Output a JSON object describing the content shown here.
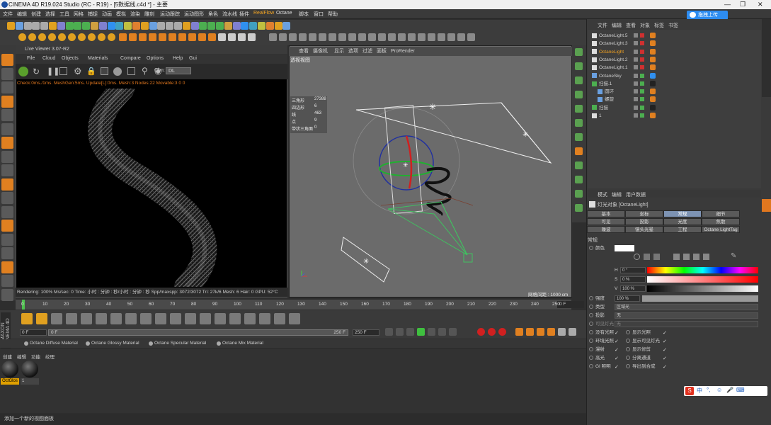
{
  "window": {
    "title": "CINEMA 4D R19.024 Studio (RC - R19) - [5数据线.c4d *] - 主要"
  },
  "menubar": [
    "文件",
    "编辑",
    "创建",
    "选择",
    "工具",
    "网格",
    "捕捉",
    "动画",
    "模拟",
    "渲染",
    "雕刻",
    "运动跟踪",
    "运动图形",
    "角色",
    "流水线",
    "插件",
    "RealFlow",
    "Octane",
    "脚本",
    "窗口",
    "帮助"
  ],
  "cloud_button": "拖拽上传",
  "liveviewer": {
    "title": "Live Viewer 3.07-R2",
    "menu": [
      "File",
      "Cloud",
      "Objects",
      "Materials",
      "Compare",
      "Options",
      "Help",
      "Gui"
    ],
    "chn_label": "Chn:",
    "chn_value": "DL",
    "status": "Check:0ms./1ms. MeshGen:5ms. Update[L]:0ms. Mesh:3 Nodes:22 Movable:3  0 0",
    "render_info": "Rendering: 100%   Ms/sec: 0   Time: 小时 : 分钟 : 秒/小时 : 分钟 : 秒   Spp/maxspp: 3072/3072   Tri: 27k/6   Mesh: 6   Hair: 0   GPU:   52°C"
  },
  "viewport": {
    "menu": [
      "查看",
      "摄像机",
      "显示",
      "选项",
      "过滤",
      "面板",
      "ProRender"
    ],
    "label": "透视视图",
    "stats": [
      [
        "三角形",
        "27388"
      ],
      [
        "四边形",
        "6"
      ],
      [
        "线",
        "463"
      ],
      [
        "点",
        "9"
      ],
      [
        "带状三角面",
        "0"
      ]
    ],
    "grid_info": "网格间距 : 1000 cm"
  },
  "timeline": {
    "ticks": [
      "0",
      "10",
      "20",
      "30",
      "40",
      "50",
      "60",
      "70",
      "80",
      "90",
      "100",
      "110",
      "120",
      "130",
      "140",
      "150",
      "160",
      "170",
      "180",
      "190",
      "200",
      "210",
      "220",
      "230",
      "240",
      "250"
    ],
    "end_frame": "0 F"
  },
  "anim": {
    "start": "0 F",
    "range_start": "0 F",
    "range_end": "250 F",
    "end": "250 F"
  },
  "materials": {
    "tabs": [
      "Octane Diffuse Material",
      "Octane Glossy Material",
      "Octane Specular Material",
      "Octane Mix Material"
    ],
    "menu": [
      "创建",
      "编辑",
      "功能",
      "纹理"
    ],
    "items": [
      "OctGlos",
      "1"
    ]
  },
  "status_bar": "添加一个新的视图面板",
  "object_manager": {
    "menu": [
      "文件",
      "编辑",
      "查看",
      "对象",
      "标签",
      "书签"
    ],
    "objects": [
      "OctaneLight.5",
      "OctaneLight.3",
      "OctaneLight",
      "OctaneLight.2",
      "OctaneLight.1",
      "OctaneSky",
      "扫描.1",
      "圆环",
      "螺旋",
      "扫描",
      "1"
    ]
  },
  "attributes": {
    "menu": [
      "模式",
      "编辑",
      "用户数据"
    ],
    "object_title": "灯光对象 [OctaneLight]",
    "tabs": [
      "基本",
      "坐标",
      "常规",
      "细节",
      "可见",
      "投影",
      "光度",
      "焦散",
      "噪波",
      "镜头光晕",
      "工程",
      "Octane LightTag"
    ],
    "section": "常规",
    "color_label": "颜色",
    "h_label": "H",
    "h_value": "0 °",
    "s_label": "S",
    "s_value": "0 %",
    "v_label": "V",
    "v_value": "100 %",
    "intensity_label": "强度",
    "intensity_value": "100 %",
    "type_label": "类型",
    "type_value": "区域光",
    "shadow_label": "投影",
    "shadow_value": "无",
    "visible_label": "可见灯光",
    "visible_value": "无",
    "options_left": [
      "没有光照",
      "环境光照",
      "漫射",
      "高光",
      "GI 照明"
    ],
    "options_right": [
      "显示光照",
      "显示可见灯光",
      "显示修剪",
      "分离通道",
      "导出到合成"
    ]
  },
  "ime": [
    "中",
    "°,",
    "☺",
    "🎤",
    "⌨"
  ]
}
